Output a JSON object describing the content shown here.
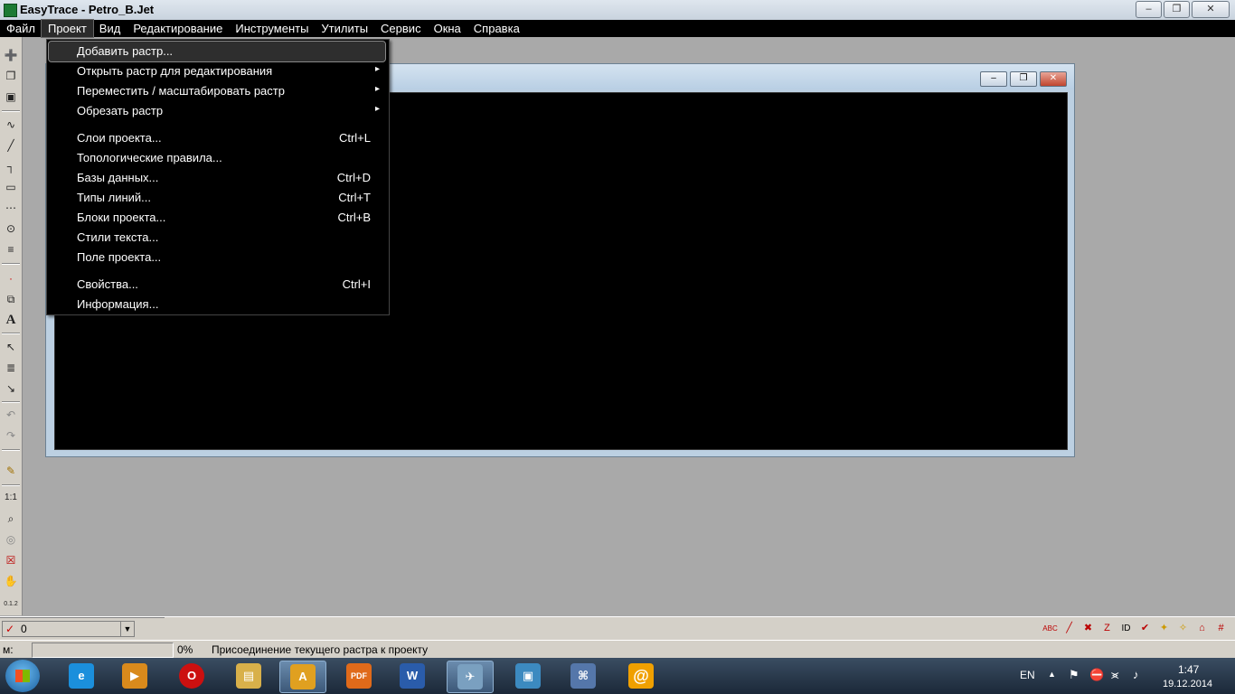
{
  "window": {
    "title": "EasyTrace - Petro_B.Jet",
    "min_glyph": "‒",
    "max_glyph": "❐",
    "close_glyph": "✕"
  },
  "menubar": [
    "Файл",
    "Проект",
    "Вид",
    "Редактирование",
    "Инструменты",
    "Утилиты",
    "Сервис",
    "Окна",
    "Справка"
  ],
  "menu_active": "Проект",
  "project_menu": {
    "items": [
      {
        "label": "Добавить растр...",
        "shortcut": "",
        "submenu": false,
        "highlighted": true
      },
      {
        "label": "Открыть растр для редактирования",
        "shortcut": "",
        "submenu": true
      },
      {
        "label": "Переместить / масштабировать растр",
        "shortcut": "",
        "submenu": true
      },
      {
        "label": "Обрезать растр",
        "shortcut": "",
        "submenu": true
      },
      {
        "label": "Слои проекта...",
        "shortcut": "Ctrl+L",
        "submenu": false
      },
      {
        "label": "Топологические правила...",
        "shortcut": "",
        "submenu": false
      },
      {
        "label": "Базы данных...",
        "shortcut": "Ctrl+D",
        "submenu": false
      },
      {
        "label": "Типы линий...",
        "shortcut": "Ctrl+T",
        "submenu": false
      },
      {
        "label": "Блоки проекта...",
        "shortcut": "Ctrl+B",
        "submenu": false
      },
      {
        "label": "Стили текста...",
        "shortcut": "",
        "submenu": false
      },
      {
        "label": "Поле проекта...",
        "shortcut": "",
        "submenu": false
      },
      {
        "label": "Свойства...",
        "shortcut": "Ctrl+I",
        "submenu": false
      },
      {
        "label": "Информация...",
        "shortcut": "",
        "submenu": false
      }
    ],
    "submenu_arrow": "▸"
  },
  "left_toolbar": {
    "glyphs": [
      "➕",
      "❐",
      "▣",
      "∿",
      "╱",
      "┐",
      "▭",
      "⋯",
      "⊙",
      "≡",
      "·",
      "⧉",
      "A",
      "↖",
      "≣",
      "↘",
      "↶",
      "↷",
      "✎",
      "1:1",
      "⌕",
      "◎",
      "☒",
      "✋",
      "0.1.2"
    ],
    "icons": [
      "new-icon",
      "open-icon",
      "save-icon",
      "spline-icon",
      "polyline-icon",
      "orthogonal-line-icon",
      "rectangle-icon",
      "dotted-line-icon",
      "circle-icon",
      "hatch-icon",
      "point-icon",
      "block-icon",
      "text-icon",
      "select-icon",
      "select-group-icon",
      "select-node-icon",
      "undo-icon",
      "redo-icon",
      "pencil-icon",
      "scale-1-1-icon",
      "zoom-icon",
      "zoom-window-icon",
      "zoom-extents-icon",
      "pan-hand-icon",
      "measure-icon"
    ]
  },
  "layer_bar": {
    "check": "✓",
    "value": "0",
    "dropdown_glyph": "▼"
  },
  "right_tools": [
    "ABC",
    "╱",
    "✖",
    "Z",
    "ID",
    "✔",
    "✦",
    "✧",
    "⌂",
    "#"
  ],
  "status": {
    "label": "м:",
    "progress": "0%",
    "message": "Присоединение текущего растра к проекту"
  },
  "taskbar": {
    "apps": [
      {
        "name": "internet-explorer",
        "glyph": "e",
        "color": "#1b8fdc"
      },
      {
        "name": "media-player",
        "glyph": "▶",
        "color": "#d98a1c"
      },
      {
        "name": "opera",
        "glyph": "O",
        "color": "#cc1010"
      },
      {
        "name": "file-explorer",
        "glyph": "▤",
        "color": "#d8b04a"
      },
      {
        "name": "easytrace",
        "glyph": "A",
        "color": "#e0a020"
      },
      {
        "name": "pdf",
        "glyph": "PDF",
        "color": "#e06a1a"
      },
      {
        "name": "word",
        "glyph": "W",
        "color": "#2a5caa"
      },
      {
        "name": "send",
        "glyph": "✈",
        "color": "#7aa0c0"
      },
      {
        "name": "photos",
        "glyph": "▣",
        "color": "#3c8ac0"
      },
      {
        "name": "network",
        "glyph": "⌘",
        "color": "#5577aa"
      },
      {
        "name": "mail-agent",
        "glyph": "@",
        "color": "#f0a000"
      }
    ],
    "lang": "EN",
    "tray_glyphs": {
      "arrow": "▲",
      "flag": "⚑",
      "shield": "⛔",
      "wifi": "⪤",
      "volume": "♪"
    },
    "time": "1:47",
    "date": "19.12.2014"
  }
}
